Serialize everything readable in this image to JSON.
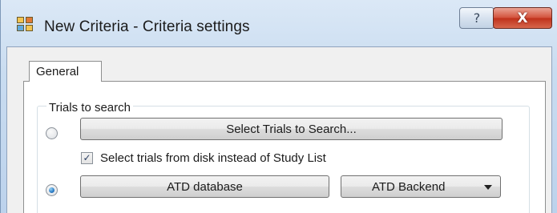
{
  "window": {
    "title": "New Criteria - Criteria settings",
    "help_glyph": "?",
    "close_glyph": "X"
  },
  "tabs": [
    {
      "label": "General",
      "selected": true
    }
  ],
  "trials_group": {
    "legend": "Trials to search",
    "select_trials_button": "Select Trials to Search...",
    "select_trials_radio_checked": false,
    "from_disk_checkbox": {
      "label": "Select trials from disk instead of Study List",
      "checked": true,
      "glyph": "✓"
    },
    "atd_radio_checked": true,
    "atd_database_button": "ATD database",
    "backend_select": {
      "value": "ATD Backend"
    }
  },
  "icons": [
    "app-icon",
    "help-icon",
    "close-icon",
    "chevron-down-icon"
  ]
}
